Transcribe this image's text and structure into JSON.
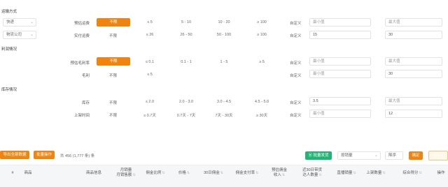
{
  "section1": {
    "title": "运输方式",
    "select_a": "快递",
    "select_b": "物流公司",
    "rows": [
      {
        "label": "预估运费",
        "button": "不限",
        "v1": "≤ 5",
        "v2": "5 - 10",
        "v3": "10 - 20",
        "v4": "≥ 100",
        "custom": "自定义",
        "min": "最小值",
        "max": "最大值"
      },
      {
        "label": "实付运费",
        "button": "不限",
        "v1": "≤ 26",
        "v2": "26 - 50",
        "v3": "50 - 100",
        "v4": "≥ 100",
        "custom": "自定义",
        "min": "15",
        "max": "30"
      }
    ]
  },
  "section2": {
    "title": "利润情况",
    "rows": [
      {
        "label": "预估毛利率",
        "button": "不限",
        "v1": "≤ 0.1",
        "v2": "0.1 - 1",
        "v3": "1 - 5",
        "v4": "≥ 5",
        "custom": "自定义",
        "min": "最小值",
        "max": "最大值"
      },
      {
        "label": "毛利",
        "button": "不限",
        "v1": "≤ 5",
        "v2": "",
        "v3": "",
        "v4": "",
        "custom": "自定义",
        "min": "最小值",
        "max": "30"
      }
    ]
  },
  "section3": {
    "title": "库存情况",
    "rows": [
      {
        "label": "库存",
        "button": "不限",
        "v1": "≤ 2.0",
        "v2": "2.0 - 3.0",
        "v3": "3.0 - 4.5",
        "v4": "4.5 - 5.0",
        "custom": "自定义",
        "min": "3.5",
        "max": "最大值"
      },
      {
        "label": "上架时间",
        "button": "不限",
        "v1": "≤ 0.7天",
        "v2": "0.7天 - 7天",
        "v3": "7天 - 30天",
        "v4": "≥ 30天",
        "custom": "自定义",
        "min": "最小值",
        "max": "12"
      }
    ]
  },
  "toolbar": {
    "export_btn": "导出全部数据",
    "batch_btn": "批量操作",
    "count_text": "共 456 (1,777 条) 条",
    "green_btn": "批量发货",
    "sort_select": "按销量",
    "sort_order": "降序",
    "search_btn": "确定",
    "columns": [
      "#",
      "商品",
      "商品信息",
      "月销量\n月销售额",
      "佣金比例",
      "价格",
      "30日佣金",
      "佣金支付率",
      "预估佣金\n收入",
      "近30日带货\n达人数量",
      "直播销量",
      "上架数量",
      "综合得分",
      "操作"
    ]
  },
  "colors": {
    "accent": "#f0840e",
    "green": "#21b573",
    "border": "#e4e4e4",
    "header_bg": "#f5f6f8"
  }
}
